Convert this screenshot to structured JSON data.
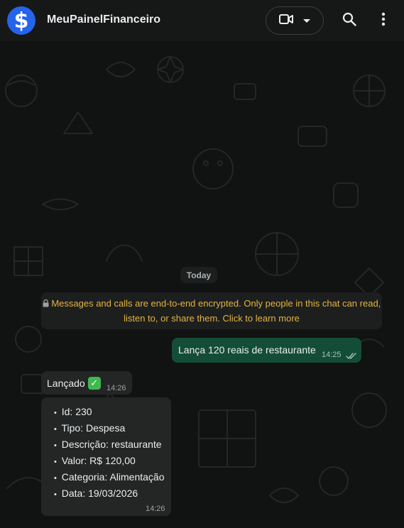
{
  "header": {
    "avatar_symbol": "$",
    "avatar_color": "#2563eb",
    "title": "MeuPainelFinanceiro",
    "icons": [
      "video-call-icon",
      "chevron-down-icon",
      "search-icon",
      "more-vert-icon"
    ]
  },
  "chat": {
    "day_label": "Today",
    "encryption_notice": "Messages and calls are end-to-end encrypted. Only people in this chat can read, listen to, or share them. Click to learn more",
    "messages": [
      {
        "direction": "outgoing",
        "text": "Lança 120 reais de restaurante",
        "time": "14:25",
        "status": "read"
      },
      {
        "direction": "incoming",
        "text": "Lançado",
        "emoji": "check-mark-button-icon",
        "time": "14:26"
      },
      {
        "direction": "incoming",
        "lines": [
          "Id: 230",
          "Tipo: Despesa",
          "Descrição: restaurante",
          "Valor: R$ 120,00",
          "Categoria: Alimentação",
          "Data: 19/03/2026"
        ],
        "time": "14:26"
      }
    ]
  },
  "colors": {
    "outgoing_bubble": "#144d37",
    "incoming_bubble": "#242626",
    "notice_text": "#e3b341",
    "header_bg": "#161717"
  }
}
